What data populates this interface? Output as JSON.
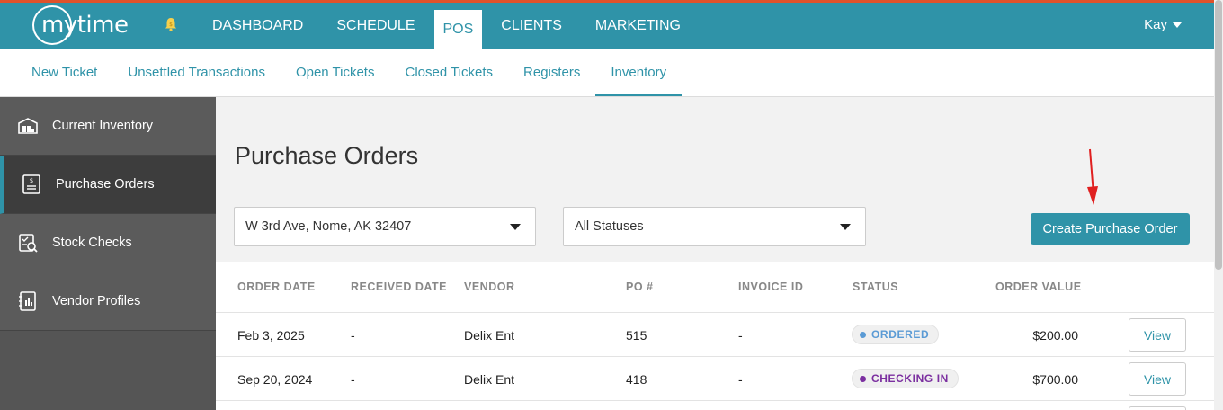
{
  "brand": {
    "name": "mytime",
    "accent": "#2f93a8",
    "topline": "#e0522b"
  },
  "topnav": {
    "items": [
      {
        "label": "DASHBOARD"
      },
      {
        "label": "SCHEDULE"
      },
      {
        "label": "POS",
        "active": true
      },
      {
        "label": "CLIENTS"
      },
      {
        "label": "MARKETING"
      }
    ],
    "user": "Kay"
  },
  "subnav": {
    "items": [
      {
        "label": "New Ticket"
      },
      {
        "label": "Unsettled Transactions"
      },
      {
        "label": "Open Tickets"
      },
      {
        "label": "Closed Tickets"
      },
      {
        "label": "Registers"
      },
      {
        "label": "Inventory",
        "active": true
      }
    ]
  },
  "sidebar": {
    "items": [
      {
        "label": "Current Inventory",
        "icon": "warehouse-icon"
      },
      {
        "label": "Purchase Orders",
        "icon": "purchase-order-icon",
        "active": true
      },
      {
        "label": "Stock Checks",
        "icon": "stock-check-icon"
      },
      {
        "label": "Vendor Profiles",
        "icon": "vendor-profile-icon"
      }
    ]
  },
  "main": {
    "title": "Purchase Orders",
    "location_select": "W 3rd Ave, Nome, AK 32407",
    "status_select": "All Statuses",
    "create_button": "Create Purchase Order"
  },
  "table": {
    "headers": [
      "ORDER DATE",
      "RECEIVED DATE",
      "VENDOR",
      "PO #",
      "INVOICE ID",
      "STATUS",
      "ORDER VALUE"
    ],
    "rows": [
      {
        "order_date": "Feb 3, 2025",
        "received_date": "-",
        "vendor": "Delix Ent",
        "po": "515",
        "invoice": "-",
        "status": "ORDERED",
        "status_color": "#5b9bd5",
        "value": "$200.00",
        "action": "View"
      },
      {
        "order_date": "Sep 20, 2024",
        "received_date": "-",
        "vendor": "Delix Ent",
        "po": "418",
        "invoice": "-",
        "status": "CHECKING IN",
        "status_color": "#7b2fa0",
        "value": "$700.00",
        "action": "View"
      }
    ]
  }
}
